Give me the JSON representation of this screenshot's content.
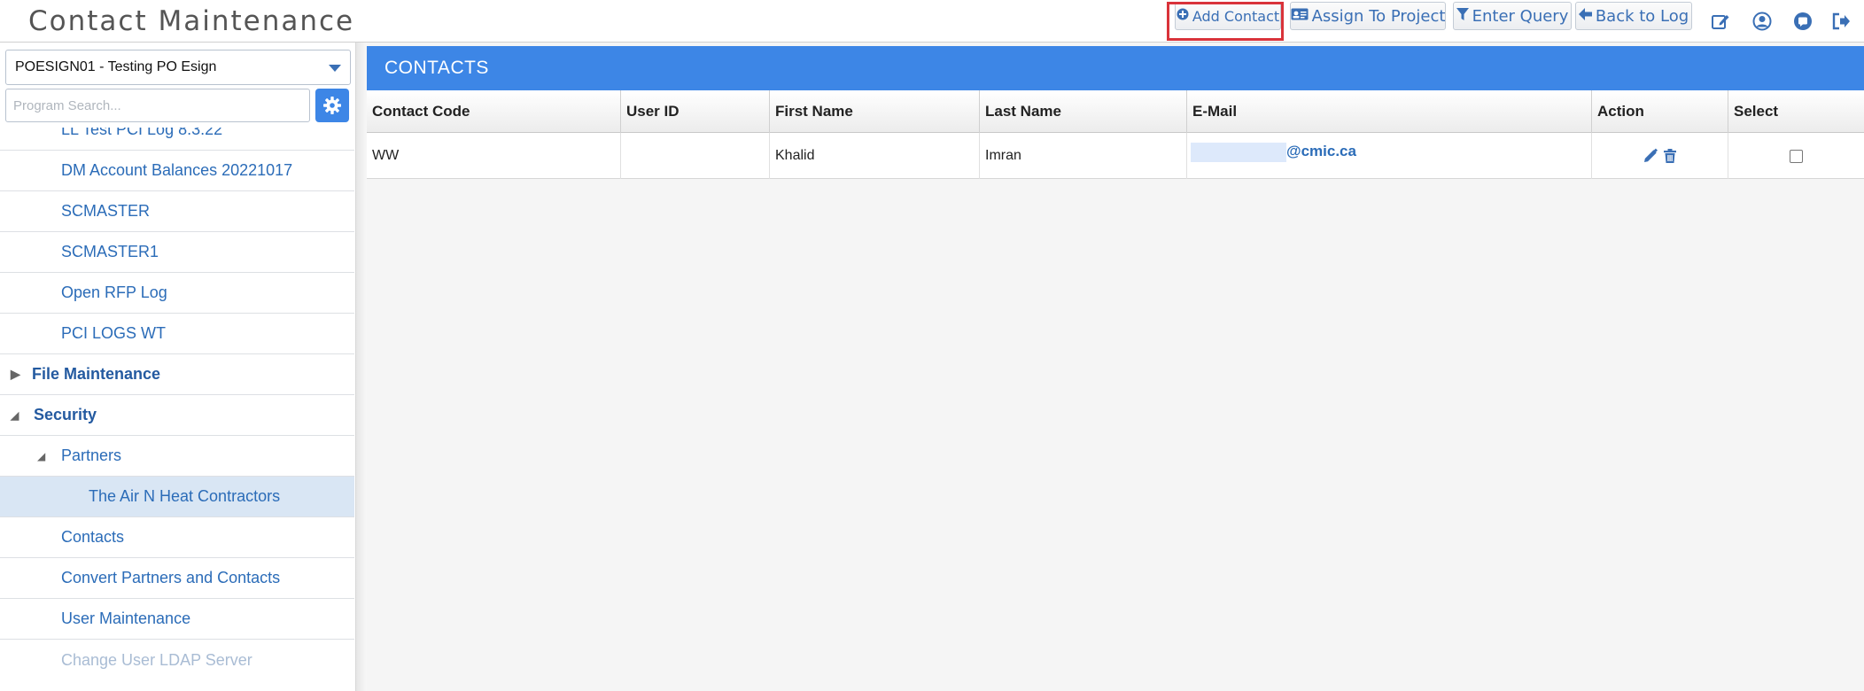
{
  "app": {
    "title": "Contact Maintenance"
  },
  "toolbar": {
    "add_contact": "Add Contact",
    "assign_to_project": "Assign To Project",
    "enter_query": "Enter Query",
    "back_to_log": "Back to Log"
  },
  "header_icons": [
    "edit-icon",
    "user-icon",
    "chat-icon",
    "logout-icon"
  ],
  "sidebar": {
    "project_selected": "POESIGN01 - Testing PO Esign",
    "search_placeholder": "Program Search...",
    "items": [
      {
        "label": "LL Test PCI Log 8.3.22"
      },
      {
        "label": "DM Account Balances 20221017"
      },
      {
        "label": "SCMASTER"
      },
      {
        "label": "SCMASTER1"
      },
      {
        "label": "Open RFP Log"
      },
      {
        "label": "PCI LOGS WT"
      },
      {
        "label": "File Maintenance"
      },
      {
        "label": "Security"
      },
      {
        "label": "Partners"
      },
      {
        "label": "The Air N Heat Contractors"
      },
      {
        "label": "Contacts"
      },
      {
        "label": "Convert Partners and Contacts"
      },
      {
        "label": "User Maintenance"
      },
      {
        "label": "Change User LDAP Server"
      }
    ]
  },
  "panel": {
    "title": "CONTACTS"
  },
  "grid": {
    "columns": [
      "Contact Code",
      "User ID",
      "First Name",
      "Last Name",
      "E-Mail",
      "Action",
      "Select"
    ],
    "rows": [
      {
        "contact_code": "WW",
        "user_id": "",
        "first_name": "Khalid",
        "last_name": "Imran",
        "email": "@cmic.ca",
        "selected": false
      }
    ]
  },
  "colors": {
    "accent": "#3d86e6",
    "link": "#2b6cb8",
    "highlight_box": "#d9333a",
    "selected_row": "#d9e6f4"
  }
}
